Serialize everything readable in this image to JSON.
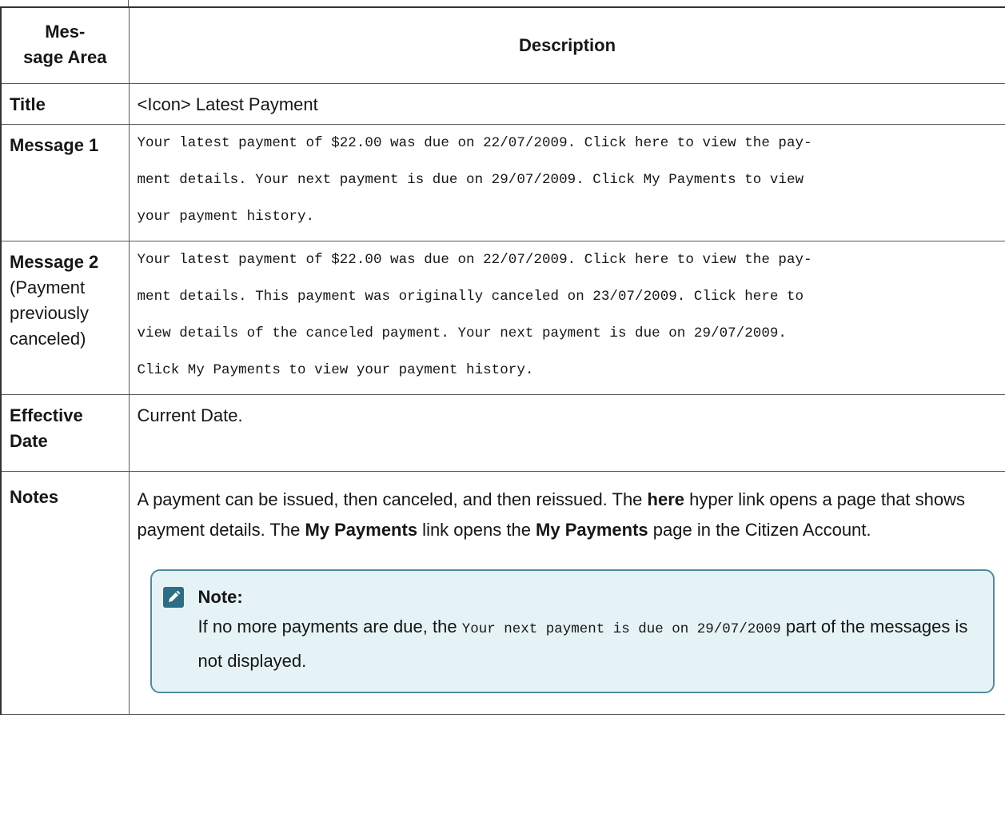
{
  "table": {
    "header": {
      "area_line1": "Mes-",
      "area_line2": "sage Area",
      "description": "Description"
    },
    "rows": {
      "title": {
        "area": "Title",
        "description": "<Icon> Latest Payment"
      },
      "message1": {
        "area": "Message 1",
        "lines": [
          "Your latest payment of $22.00 was due on 22/07/2009. Click here to view the pay-",
          "ment details. Your next payment is due on 29/07/2009. Click My Payments to view",
          "your payment history."
        ]
      },
      "message2": {
        "area": "Message 2",
        "area_sub": [
          "(Payment",
          "previously",
          "canceled)"
        ],
        "lines": [
          "Your latest payment of $22.00 was due on 22/07/2009. Click here to view the pay-",
          "ment details. This payment was originally canceled on 23/07/2009. Click here to",
          "view details of the canceled payment. Your next payment is due on 29/07/2009.",
          "Click My Payments to view your payment history."
        ]
      },
      "effective_date": {
        "area_line1": "Effective",
        "area_line2": "Date",
        "description": "Current Date."
      },
      "notes": {
        "area": "Notes",
        "text": {
          "p1": "A payment can be issued, then canceled, and then reissued. The ",
          "b1": "here",
          "p2": " hyper link opens a page that shows payment details. The ",
          "b2": "My Payments",
          "p3": " link opens the ",
          "b3": "My Payments",
          "p4": " page in the Citizen Account."
        },
        "note": {
          "icon": "pencil-icon",
          "title": "Note:",
          "pre": "If no more payments are due, the ",
          "code": "Your next payment is due on 29/07/2009",
          "post": " part of the messages is not displayed."
        }
      }
    }
  },
  "colors": {
    "note_background": "#e6f3f6",
    "note_border": "#4f8ba0",
    "note_icon": "#2b6e85"
  }
}
